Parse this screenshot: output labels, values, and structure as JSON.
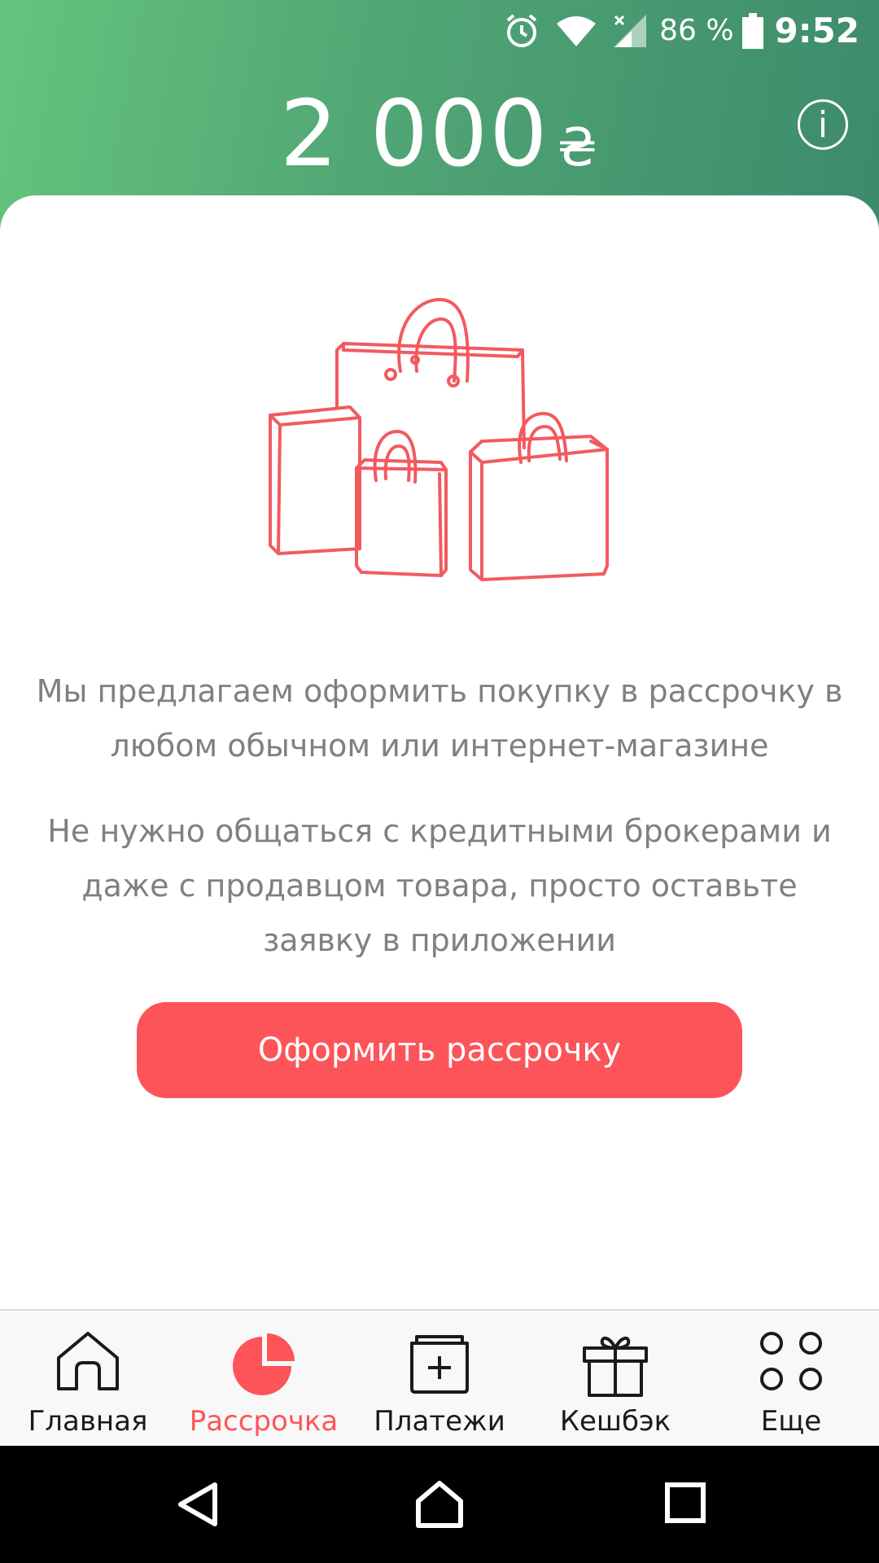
{
  "status_bar": {
    "battery_percent": "86 %",
    "time": "9:52",
    "icons": [
      "alarm-icon",
      "wifi-icon",
      "signal-icon",
      "battery-icon"
    ]
  },
  "header": {
    "amount": "2 000",
    "currency_symbol": "₴",
    "info_icon": "info-icon"
  },
  "main": {
    "illustration": "shopping-bags-illustration",
    "paragraph_1": "Мы предлагаем оформить покупку в рассрочку в любом обычном или интернет-магазине",
    "paragraph_2": "Не нужно общаться с кредитными брокерами и даже с продавцом товара, просто оставьте заявку в приложении",
    "cta_label": "Оформить рассрочку"
  },
  "tabs": [
    {
      "label": "Главная",
      "icon": "home-icon",
      "active": false
    },
    {
      "label": "Рассрочка",
      "icon": "pie-chart-icon",
      "active": true
    },
    {
      "label": "Платежи",
      "icon": "payments-icon",
      "active": false
    },
    {
      "label": "Кешбэк",
      "icon": "gift-icon",
      "active": false
    },
    {
      "label": "Еще",
      "icon": "more-icon",
      "active": false
    }
  ],
  "colors": {
    "accent": "#fd5459",
    "header_start": "#65c47c",
    "header_end": "#3d8a6c",
    "text_muted": "#808080"
  },
  "system_nav": [
    "back-icon",
    "home-nav-icon",
    "recents-icon"
  ]
}
